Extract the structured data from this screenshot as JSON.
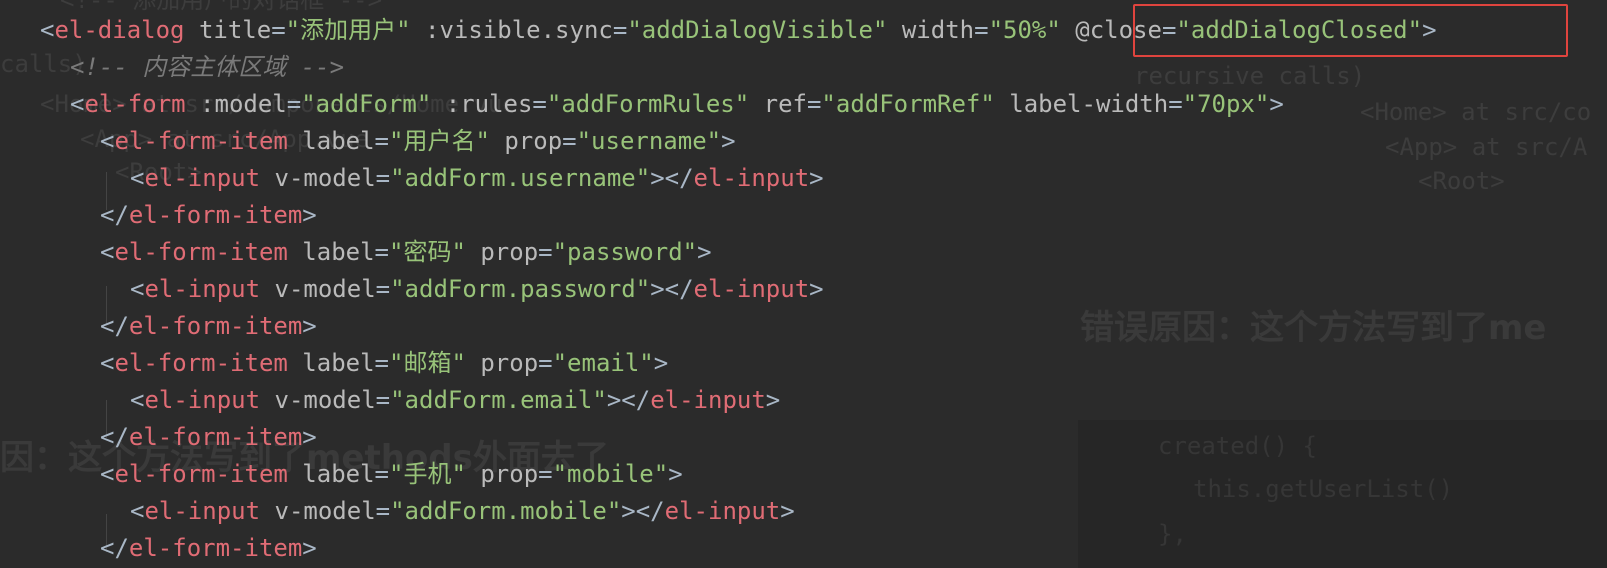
{
  "editor": {
    "lines": [
      {
        "indent": "<",
        "tag": "el-dialog",
        "parts": [
          {
            "cls": "a",
            "text": " title"
          },
          {
            "cls": "p",
            "text": "="
          },
          {
            "cls": "s",
            "text": "\"添加用户\""
          },
          {
            "cls": "a",
            "text": " :visible.sync"
          },
          {
            "cls": "p",
            "text": "="
          },
          {
            "cls": "s",
            "text": "\"addDialogVisible\""
          },
          {
            "cls": "a",
            "text": " width"
          },
          {
            "cls": "p",
            "text": "="
          },
          {
            "cls": "s",
            "text": "\"50%\""
          },
          {
            "cls": "a",
            "text": " @close"
          },
          {
            "cls": "p",
            "text": "="
          },
          {
            "cls": "s",
            "text": "\"addDialogClosed\""
          },
          {
            "cls": "p",
            "text": ">"
          }
        ]
      },
      {
        "comment": "<!-- 内容主体区域 -->"
      },
      {
        "tag": "el-form",
        "parts": [
          {
            "cls": "a",
            "text": " :model"
          },
          {
            "cls": "p",
            "text": "="
          },
          {
            "cls": "s",
            "text": "\"addForm\""
          },
          {
            "cls": "a",
            "text": " :rules"
          },
          {
            "cls": "p",
            "text": "="
          },
          {
            "cls": "s",
            "text": "\"addFormRules\""
          },
          {
            "cls": "a",
            "text": " ref"
          },
          {
            "cls": "p",
            "text": "="
          },
          {
            "cls": "s",
            "text": "\"addFormRef\""
          },
          {
            "cls": "a",
            "text": " label-width"
          },
          {
            "cls": "p",
            "text": "="
          },
          {
            "cls": "s",
            "text": "\"70px\""
          },
          {
            "cls": "p",
            "text": ">"
          }
        ]
      },
      {
        "tag": "el-form-item",
        "parts": [
          {
            "cls": "a",
            "text": " label"
          },
          {
            "cls": "p",
            "text": "="
          },
          {
            "cls": "s",
            "text": "\"用户名\""
          },
          {
            "cls": "a",
            "text": " prop"
          },
          {
            "cls": "p",
            "text": "="
          },
          {
            "cls": "s",
            "text": "\"username\""
          },
          {
            "cls": "p",
            "text": ">"
          }
        ]
      },
      {
        "tag": "el-input",
        "parts": [
          {
            "cls": "a",
            "text": " v-model"
          },
          {
            "cls": "p",
            "text": "="
          },
          {
            "cls": "s",
            "text": "\"addForm.username\""
          },
          {
            "cls": "p",
            "text": "></"
          },
          {
            "cls": "tag",
            "text": "el-input"
          },
          {
            "cls": "p",
            "text": ">"
          }
        ]
      },
      {
        "close": "el-form-item"
      },
      {
        "tag": "el-form-item",
        "parts": [
          {
            "cls": "a",
            "text": " label"
          },
          {
            "cls": "p",
            "text": "="
          },
          {
            "cls": "s",
            "text": "\"密码\""
          },
          {
            "cls": "a",
            "text": " prop"
          },
          {
            "cls": "p",
            "text": "="
          },
          {
            "cls": "s",
            "text": "\"password\""
          },
          {
            "cls": "p",
            "text": ">"
          }
        ]
      },
      {
        "tag": "el-input",
        "parts": [
          {
            "cls": "a",
            "text": " v-model"
          },
          {
            "cls": "p",
            "text": "="
          },
          {
            "cls": "s",
            "text": "\"addForm.password\""
          },
          {
            "cls": "p",
            "text": "></"
          },
          {
            "cls": "tag",
            "text": "el-input"
          },
          {
            "cls": "p",
            "text": ">"
          }
        ]
      },
      {
        "close": "el-form-item"
      },
      {
        "tag": "el-form-item",
        "parts": [
          {
            "cls": "a",
            "text": " label"
          },
          {
            "cls": "p",
            "text": "="
          },
          {
            "cls": "s",
            "text": "\"邮箱\""
          },
          {
            "cls": "a",
            "text": " prop"
          },
          {
            "cls": "p",
            "text": "="
          },
          {
            "cls": "s",
            "text": "\"email\""
          },
          {
            "cls": "p",
            "text": ">"
          }
        ]
      },
      {
        "tag": "el-input",
        "parts": [
          {
            "cls": "a",
            "text": " v-model"
          },
          {
            "cls": "p",
            "text": "="
          },
          {
            "cls": "s",
            "text": "\"addForm.email\""
          },
          {
            "cls": "p",
            "text": "></"
          },
          {
            "cls": "tag",
            "text": "el-input"
          },
          {
            "cls": "p",
            "text": ">"
          }
        ]
      },
      {
        "close": "el-form-item"
      },
      {
        "tag": "el-form-item",
        "parts": [
          {
            "cls": "a",
            "text": " label"
          },
          {
            "cls": "p",
            "text": "="
          },
          {
            "cls": "s",
            "text": "\"手机\""
          },
          {
            "cls": "a",
            "text": " prop"
          },
          {
            "cls": "p",
            "text": "="
          },
          {
            "cls": "s",
            "text": "\"mobile\""
          },
          {
            "cls": "p",
            "text": ">"
          }
        ]
      },
      {
        "tag": "el-input",
        "parts": [
          {
            "cls": "a",
            "text": " v-model"
          },
          {
            "cls": "p",
            "text": "="
          },
          {
            "cls": "s",
            "text": "\"addForm.mobile\""
          },
          {
            "cls": "p",
            "text": "></"
          },
          {
            "cls": "tag",
            "text": "el-input"
          },
          {
            "cls": "p",
            "text": ">"
          }
        ]
      },
      {
        "close": "el-form-item"
      }
    ]
  },
  "background": {
    "ghost_texts": [
      "<!-- 添加用户的对话框 -->",
      "calls)",
      "<Home> at src/components/Home.vue",
      "<App> at src/App.vue",
      "<Root>",
      "recursive calls)",
      "<Home> at src/co",
      "<App> at src/A",
      "<Root>"
    ],
    "ghost_headings": [
      "错误原因：这个方法写到了me",
      "因：这个方法写到了methods外面去了"
    ],
    "ghost_code": [
      "created() {",
      "this.getUserList()",
      "},"
    ]
  },
  "colors": {
    "background": "#2b2b2b",
    "tag": "#e06c75",
    "attribute": "#bababa",
    "string": "#98c379",
    "highlight_border": "#e0443e"
  }
}
